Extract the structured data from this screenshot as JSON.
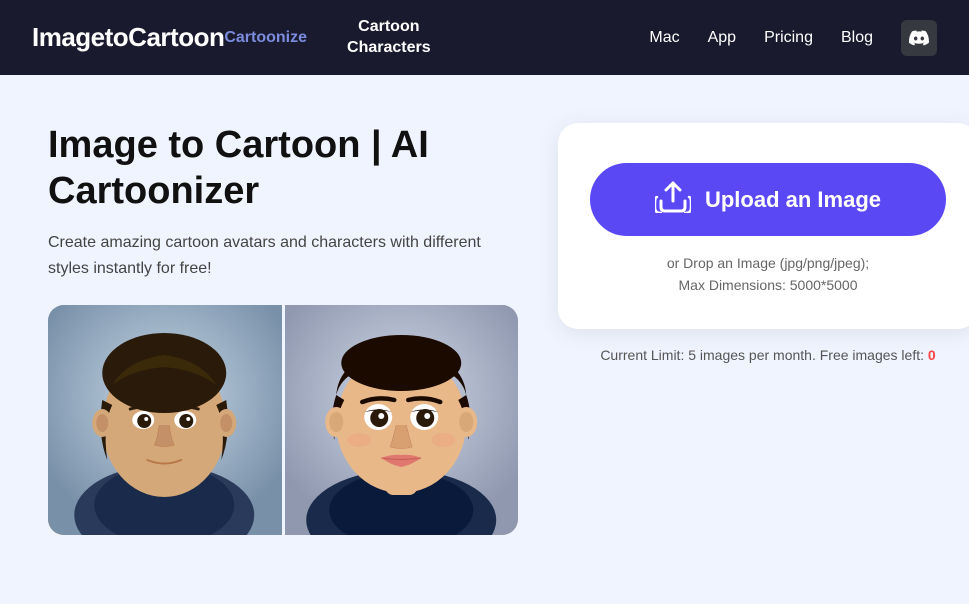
{
  "navbar": {
    "brand_main": "ImagetoCartoon",
    "brand_sub": "Cartoonize",
    "cartoon_chars_line1": "Cartoon",
    "cartoon_chars_line2": "Characters",
    "links": [
      {
        "label": "Mac",
        "name": "mac"
      },
      {
        "label": "App",
        "name": "app"
      },
      {
        "label": "Pricing",
        "name": "pricing"
      },
      {
        "label": "Blog",
        "name": "blog"
      }
    ],
    "discord_icon": "💬"
  },
  "main": {
    "title": "Image to Cartoon | AI Cartoonizer",
    "subtitle": "Create amazing cartoon avatars and characters with different styles instantly for free!",
    "upload_button_label": "Upload an Image",
    "upload_hint_line1": "or Drop an Image (jpg/png/jpeg);",
    "upload_hint_line2": "Max Dimensions: 5000*5000",
    "limit_text": "Current Limit: 5 images per month. Free images left: ",
    "limit_number": "0"
  }
}
